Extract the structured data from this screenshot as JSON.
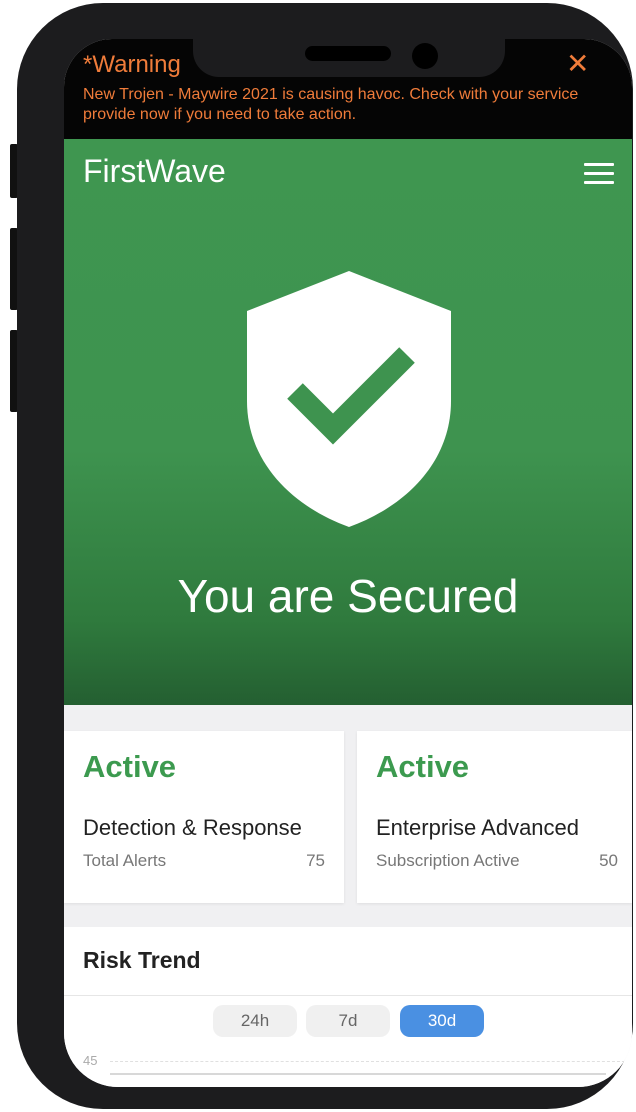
{
  "warning": {
    "title": "*Warning",
    "message": "New Trojen - Maywire 2021 is causing havoc. Check with your service provide now if you need to take action.",
    "close_icon": "close-icon"
  },
  "header": {
    "brand": "FirstWave",
    "menu_icon": "hamburger-menu-icon"
  },
  "hero": {
    "status_icon": "shield-check-icon",
    "title": "You are Secured"
  },
  "cards": [
    {
      "status": "Active",
      "name": "Detection & Response",
      "meta_label": "Total Alerts",
      "meta_value": "75"
    },
    {
      "status": "Active",
      "name": "Enterprise Advanced",
      "meta_label": "Subscription Active",
      "meta_value": "50"
    }
  ],
  "risk_trend": {
    "title": "Risk Trend",
    "ranges": [
      "24h",
      "7d",
      "30d"
    ],
    "selected_range": "30d",
    "y_axis_top": "45"
  },
  "colors": {
    "brand_green": "#3f9650",
    "active_green": "#3c9a4f",
    "warning_orange": "#f07c3a",
    "selected_blue": "#4a90e2"
  }
}
